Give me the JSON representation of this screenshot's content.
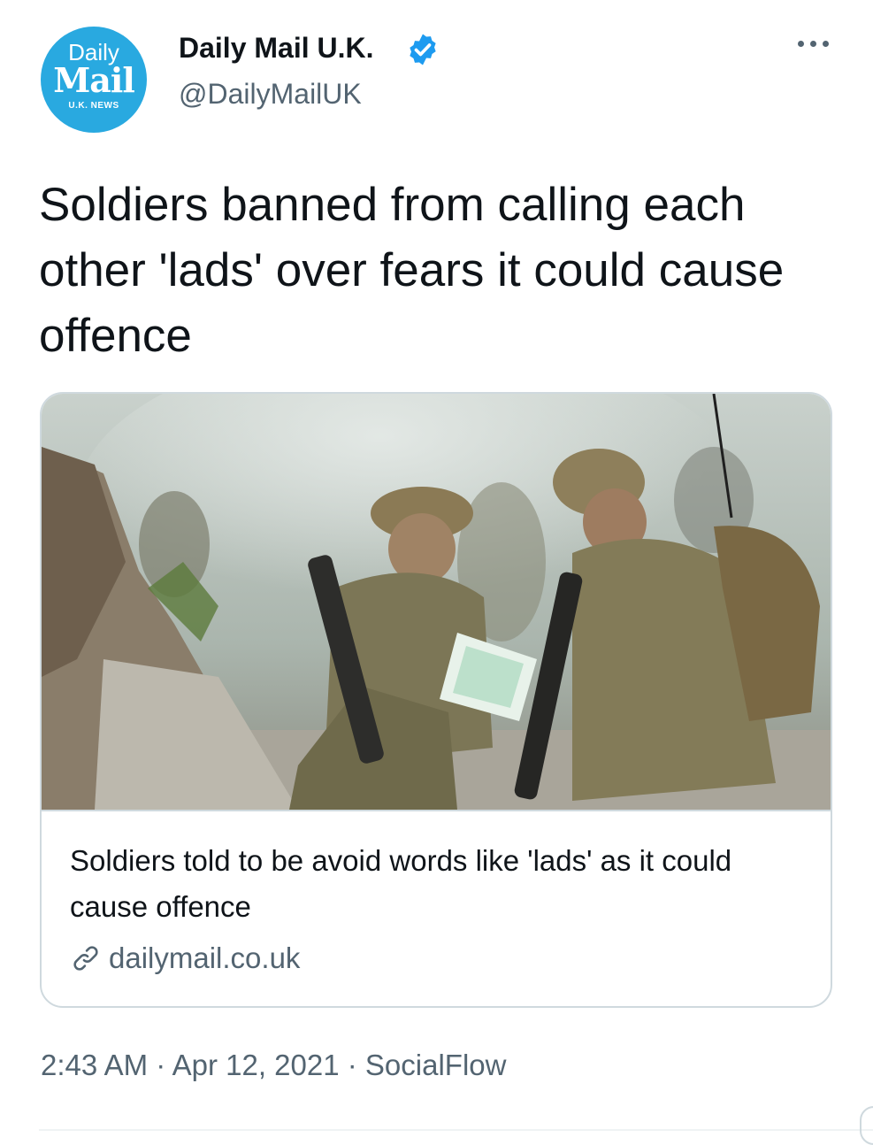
{
  "account": {
    "avatar_lines": [
      "Daily",
      "Mail",
      "U.K. NEWS"
    ],
    "name": "Daily Mail U.K.",
    "handle": "@DailyMailUK",
    "verified_icon": "verified-badge-icon",
    "more_icon": "more-options-icon"
  },
  "tweet": {
    "text": "Soldiers banned from calling each other 'lads' over fears it could cause offence"
  },
  "card": {
    "image_alt": "photo-soldiers-reading-map",
    "title": "Soldiers told to be avoid words like 'lads' as it could cause offence",
    "domain": "dailymail.co.uk",
    "link_icon": "link-icon"
  },
  "meta": {
    "time": "2:43 AM",
    "sep1": " · ",
    "date": "Apr 12, 2021",
    "sep2": " · ",
    "source": "SocialFlow"
  },
  "colors": {
    "brand_blue": "#29a9e0",
    "verified_blue": "#1d9bf0",
    "secondary_text": "#536471",
    "border": "#cfd9de"
  }
}
